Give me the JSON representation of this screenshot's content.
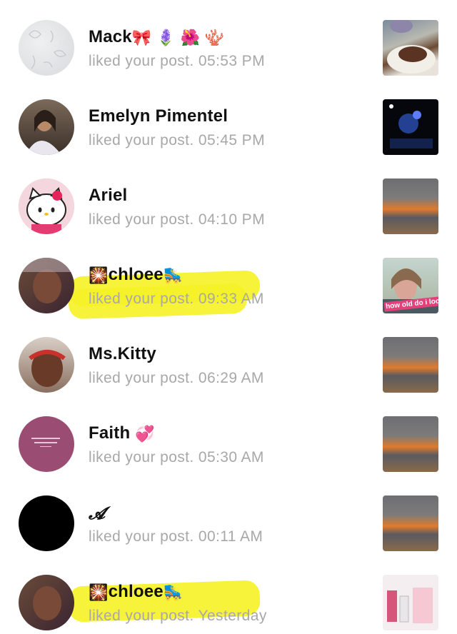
{
  "notifications": [
    {
      "name": "Mack",
      "emojis": "🎀 🪻 🌺 🪸",
      "text": "liked your post.",
      "time": "05:53 PM"
    },
    {
      "name": "Emelyn Pimentel",
      "emojis": "",
      "text": "liked your post.",
      "time": "05:45 PM"
    },
    {
      "name": "Ariel",
      "emojis": "",
      "text": "liked your post.",
      "time": "04:10 PM"
    },
    {
      "name": "chloee",
      "prefix": "🎇",
      "emojis": "🛼",
      "text": "liked your post.",
      "time": "09:33 AM"
    },
    {
      "name": "Ms.Kitty",
      "emojis": "",
      "text": "liked your post.",
      "time": "06:29 AM"
    },
    {
      "name": "Faith",
      "emojis": "💞",
      "text": "liked your post.",
      "time": "05:30 AM"
    },
    {
      "name": "𝓐",
      "emojis": "",
      "text": "liked your post.",
      "time": "00:11 AM"
    },
    {
      "name": "chloee",
      "prefix": "🎇",
      "emojis": "🛼",
      "text": "liked your post. Yesterday",
      "time": ""
    }
  ],
  "thumb_overlay_text": "how old do i look",
  "colors": {
    "highlight": "#f5f229",
    "subtext": "#a8a8a8",
    "name": "#111111"
  }
}
